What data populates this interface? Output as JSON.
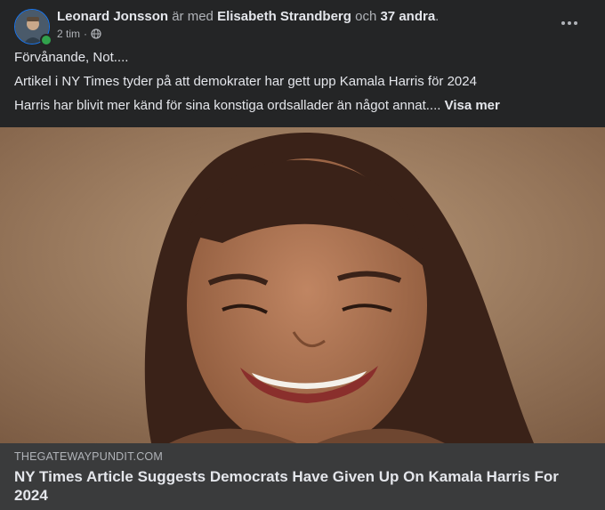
{
  "header": {
    "author": "Leonard Jonsson",
    "with_text": "är med",
    "tagged": "Elisabeth Strandberg",
    "and_text": "och",
    "others": "37 andra",
    "period": ".",
    "time": "2 tim",
    "separator": "·",
    "audience_icon": "globe-icon"
  },
  "post": {
    "line1": "Förvånande, Not....",
    "line2": "Artikel i NY Times tyder på att demokrater har gett upp Kamala Harris för 2024",
    "line3": "Harris har blivit mer känd för sina konstiga ordsallader än något annat....",
    "see_more": "Visa mer"
  },
  "link_preview": {
    "domain": "THEGATEWAYPUNDIT.COM",
    "title": "NY Times Article Suggests Democrats Have Given Up On Kamala Harris For 2024"
  },
  "colors": {
    "background": "#242526",
    "link_preview_bg": "#3a3b3c",
    "online": "#31a24c"
  }
}
